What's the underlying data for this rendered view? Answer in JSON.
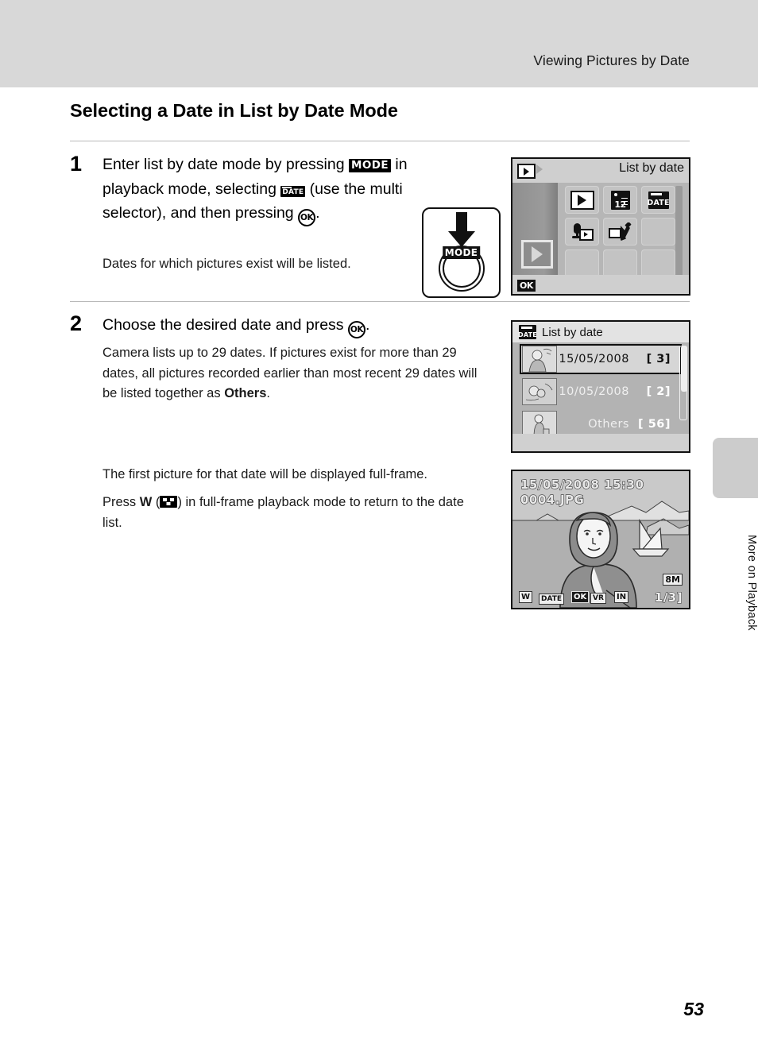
{
  "header": {
    "running_title": "Viewing Pictures by Date"
  },
  "section": {
    "title": "Selecting a Date in List by Date Mode"
  },
  "steps": [
    {
      "number": "1",
      "lead_parts": {
        "p1": "Enter list by date mode by pressing ",
        "glyph_mode": "MODE",
        "p2": " in playback mode, selecting ",
        "glyph_date": "DATE",
        "p3": " (use the multi selector), and then pressing ",
        "glyph_ok": "OK",
        "p4": "."
      },
      "body": "Dates for which pictures exist will be listed."
    },
    {
      "number": "2",
      "lead_parts": {
        "p1": "Choose the desired date and press ",
        "glyph_ok": "OK",
        "p2": "."
      },
      "body_parts": {
        "p1": "Camera lists up to 29 dates. If pictures exist for more than 29 dates, all pictures recorded earlier than most recent 29 dates will be listed together as ",
        "bold": "Others",
        "p2": "."
      },
      "note1": "The first picture for that date will be displayed full-frame.",
      "note2_parts": {
        "p1": "Press ",
        "bold_w": "W",
        "p2": " (",
        "glyph_wide": "thumbnail-icon",
        "p3": ") in full-frame playback mode to return to the date list."
      }
    }
  ],
  "mode_illustration": {
    "button_label": "MODE",
    "arrow": "down-arrow"
  },
  "camera_screen_menu": {
    "title": "List by date",
    "playback_tag": "playback-icon",
    "ok_badge": "OK",
    "cells": [
      {
        "icon": "play-icon",
        "name": "playback"
      },
      {
        "icon": "calendar-icon",
        "name": "calendar"
      },
      {
        "icon": "date-icon",
        "name": "list-by-date"
      },
      {
        "icon": "voice-recording-icon",
        "name": "voice-recording"
      },
      {
        "icon": "wrench-icon",
        "name": "setup"
      },
      {
        "icon": "empty",
        "name": "empty"
      },
      {
        "icon": "empty",
        "name": "empty"
      },
      {
        "icon": "empty",
        "name": "empty"
      },
      {
        "icon": "empty",
        "name": "empty"
      }
    ]
  },
  "camera_screen_datelist": {
    "title": "List by date",
    "title_icon": "date-icon",
    "rows": [
      {
        "label": "15/05/2008",
        "count": "[    3]",
        "selected": true,
        "thumb": "portrait-thumb"
      },
      {
        "label": "10/05/2008",
        "count": "[    2]",
        "selected": false,
        "thumb": "flowers-thumb"
      },
      {
        "label": "Others",
        "count": "[  56]",
        "selected": false,
        "thumb": "person-thumb"
      }
    ]
  },
  "camera_screen_playback": {
    "datetime": "15/05/2008 15:30",
    "filename": "0004.JPG",
    "counter": "1/",
    "counter_total": "3]",
    "image_size": "8M",
    "icons": [
      "W-icon",
      "DATE-icon",
      "OK-icon",
      "delete-icon",
      "IN-icon"
    ]
  },
  "side_tab": {
    "label": "More on Playback"
  },
  "footer": {
    "page_number": "53"
  }
}
